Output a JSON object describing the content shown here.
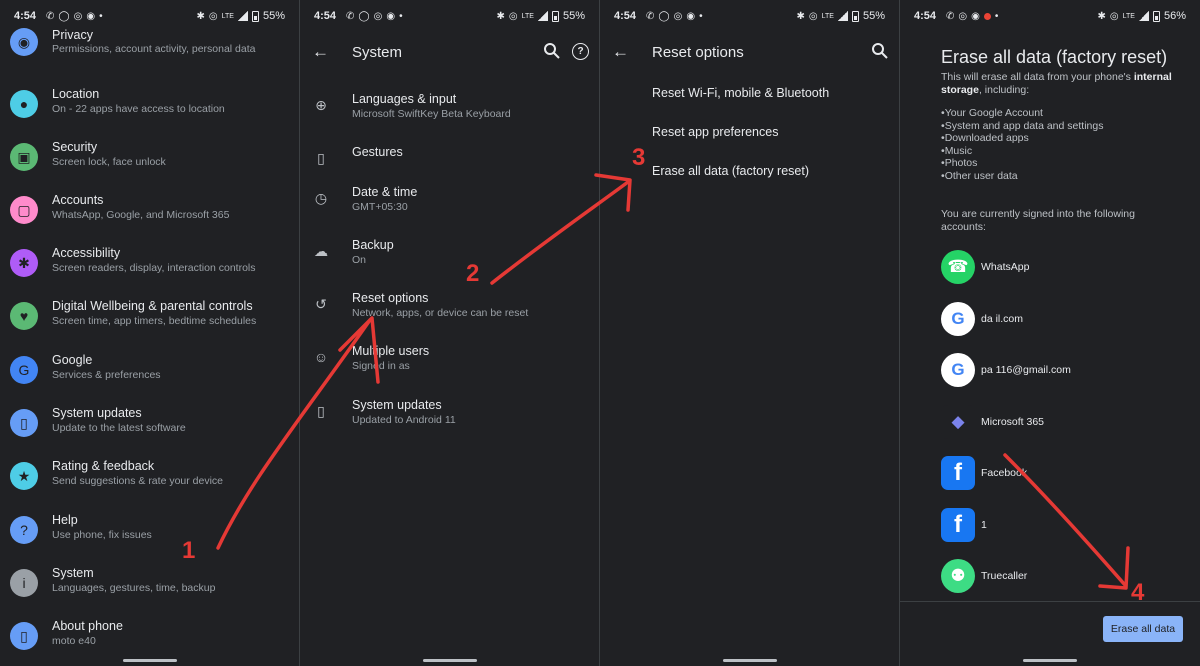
{
  "panel1": {
    "status": {
      "time": "4:54",
      "battery": "55%"
    },
    "items": [
      {
        "title": "Privacy",
        "subtitle": "Permissions, account activity, personal data",
        "icon": "privacy-icon",
        "color": "#669df6"
      },
      {
        "title": "Location",
        "subtitle": "On - 22 apps have access to location",
        "icon": "location-icon",
        "color": "#4ecde6"
      },
      {
        "title": "Security",
        "subtitle": "Screen lock, face unlock",
        "icon": "lock-icon",
        "color": "#5bb974"
      },
      {
        "title": "Accounts",
        "subtitle": "WhatsApp, Google, and Microsoft 365",
        "icon": "accounts-icon",
        "color": "#ff8bcb"
      },
      {
        "title": "Accessibility",
        "subtitle": "Screen readers, display, interaction controls",
        "icon": "accessibility-icon",
        "color": "#af5cf7"
      },
      {
        "title": "Digital Wellbeing & parental controls",
        "subtitle": "Screen time, app timers, bedtime schedules",
        "icon": "wellbeing-icon",
        "color": "#5bb974"
      },
      {
        "title": "Google",
        "subtitle": "Services & preferences",
        "icon": "google-icon",
        "color": "#4285f4"
      },
      {
        "title": "System updates",
        "subtitle": "Update to the latest software",
        "icon": "system-update-icon",
        "color": "#669df6"
      },
      {
        "title": "Rating & feedback",
        "subtitle": "Send suggestions & rate your device",
        "icon": "feedback-icon",
        "color": "#4ecde6"
      },
      {
        "title": "Help",
        "subtitle": "Use phone, fix issues",
        "icon": "help-icon",
        "color": "#669df6"
      },
      {
        "title": "System",
        "subtitle": "Languages, gestures, time, backup",
        "icon": "info-icon",
        "color": "#9aa0a6"
      },
      {
        "title": "About phone",
        "subtitle": "moto e40",
        "icon": "phone-icon",
        "color": "#669df6"
      }
    ]
  },
  "panel2": {
    "status": {
      "time": "4:54",
      "battery": "55%"
    },
    "title": "System",
    "items": [
      {
        "title": "Languages & input",
        "subtitle": "Microsoft SwiftKey Beta Keyboard",
        "icon": "globe-icon"
      },
      {
        "title": "Gestures",
        "subtitle": "",
        "icon": "gestures-icon"
      },
      {
        "title": "Date & time",
        "subtitle": "GMT+05:30",
        "icon": "clock-icon"
      },
      {
        "title": "Backup",
        "subtitle": "On",
        "icon": "backup-icon"
      },
      {
        "title": "Reset options",
        "subtitle": "Network, apps, or device can be reset",
        "icon": "history-icon"
      },
      {
        "title": "Multiple users",
        "subtitle": "Signed in as",
        "icon": "user-icon"
      },
      {
        "title": "System updates",
        "subtitle": "Updated to Android 11",
        "icon": "system-update-icon"
      }
    ]
  },
  "panel3": {
    "status": {
      "time": "4:54",
      "battery": "55%"
    },
    "title": "Reset options",
    "items": [
      "Reset Wi-Fi, mobile & Bluetooth",
      "Reset app preferences",
      "Erase all data (factory reset)"
    ]
  },
  "panel4": {
    "status": {
      "time": "4:54",
      "battery": "56%"
    },
    "title": "Erase all data (factory reset)",
    "desc_pre": "This will erase all data from your phone's ",
    "desc_bold": "internal storage",
    "desc_post": ", including:",
    "list": [
      "Your Google Account",
      "System and app data and settings",
      "Downloaded apps",
      "Music",
      "Photos",
      "Other user data"
    ],
    "signed_in": "You are currently signed into the following accounts:",
    "accounts": [
      {
        "name": "WhatsApp",
        "logo": "whatsapp-logo",
        "color": "#25d366"
      },
      {
        "name": "da                   il.com",
        "logo": "google-logo",
        "color": "#ffffff"
      },
      {
        "name": "pa                  116@gmail.com",
        "logo": "google-logo",
        "color": "#ffffff"
      },
      {
        "name": "Microsoft 365",
        "logo": "microsoft-365-logo",
        "color": "#202124"
      },
      {
        "name": "Facebook",
        "logo": "facebook-logo",
        "color": "#1877f2"
      },
      {
        "name": "1",
        "logo": "facebook-logo",
        "color": "#1877f2"
      },
      {
        "name": "Truecaller",
        "logo": "android-logo",
        "color": "#3ddc84"
      }
    ],
    "button": "Erase all data"
  },
  "annotations": {
    "color": "#e53935",
    "steps": [
      "1",
      "2",
      "3",
      "4"
    ]
  }
}
